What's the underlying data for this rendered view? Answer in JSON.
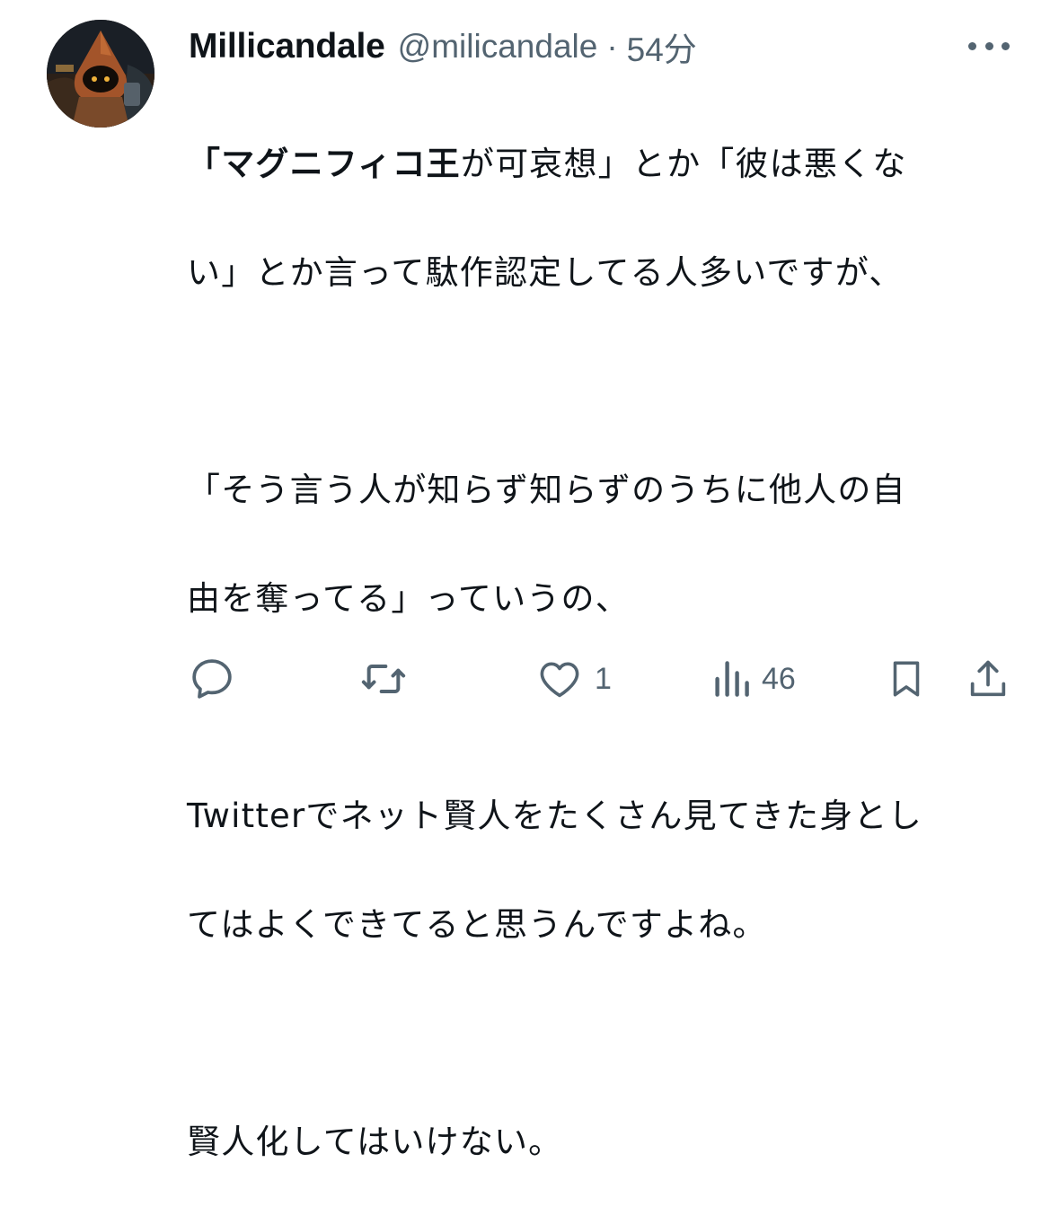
{
  "tweet": {
    "author": {
      "display_name": "Millicandale",
      "handle": "@milicandale",
      "separator": "·",
      "time": "54分"
    },
    "body": {
      "p1_line1_bold": "「マグニフィコ王",
      "p1_line1_rest": "が可哀想」とか「彼は悪くな",
      "p1_line2": "い」とか言って駄作認定してる人多いですが、",
      "p2_line1": "「そう言う人が知らず知らずのうちに他人の自",
      "p2_line2": "由を奪ってる」っていうの、",
      "p3_line1": "Twitterでネット賢人をたくさん見てきた身とし",
      "p3_line2": "てはよくできてると思うんですよね。",
      "p4_line1": "賢人化してはいけない。"
    },
    "actions": {
      "reply_icon": "reply-icon",
      "retweet_icon": "retweet-icon",
      "like_icon": "heart-icon",
      "like_count": "1",
      "views_icon": "views-icon",
      "views_count": "46",
      "bookmark_icon": "bookmark-icon",
      "share_icon": "share-icon"
    },
    "colors": {
      "text_primary": "#0f1419",
      "text_secondary": "#536471"
    }
  }
}
